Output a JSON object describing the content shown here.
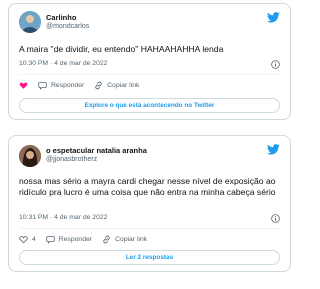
{
  "brand": {
    "accent_color": "#1d9bf0",
    "like_color": "#f91880"
  },
  "tweets": [
    {
      "display_name": "Carlinho",
      "handle": "@mondcarlos",
      "avatar_icon": "avatar-icon",
      "text": "A maira \"de dividir, eu entendo\" HAHAAHAHHA lenda",
      "timestamp": "10:30 PM · 4 de mar de 2022",
      "like_count": "",
      "reply_label": "Responder",
      "copy_label": "Copiar link",
      "cta_label": "Explore o que está acontecendo no Twitter"
    },
    {
      "display_name": "o espetacular natalia aranha",
      "handle": "@jjonasbrotherz",
      "avatar_icon": "avatar-icon",
      "text": "nossa mas sério  a mayra cardi chegar nesse nível de exposição ao ridículo pra lucro é uma coisa que não entra na minha cabeça sério",
      "timestamp": "10:31 PM · 4 de mar de 2022",
      "like_count": "4",
      "reply_label": "Responder",
      "copy_label": "Copiar link",
      "cta_label": "Ler 2 respostas"
    }
  ]
}
